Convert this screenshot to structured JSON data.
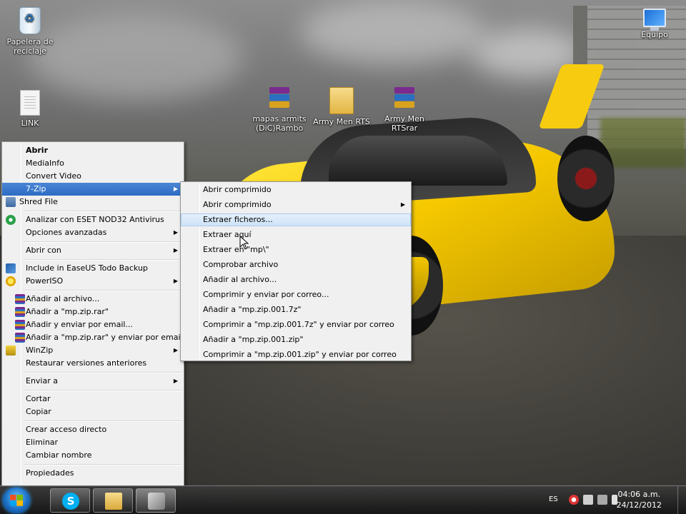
{
  "desktop": {
    "icons": {
      "recycle_bin": "Papelera de reciclaje",
      "link": "LINK",
      "mapas": "mapas armits (DiC)Rambo",
      "army_men_folder": "Army Men RTS",
      "army_men_rar": "Army Men RTSrar",
      "equipo": "Equipo"
    }
  },
  "context_menu": {
    "open": "Abrir",
    "mediainfo": "MediaInfo",
    "convert_video": "Convert Video",
    "seven_zip": "7-Zip",
    "shred_file": "Shred File",
    "eset": "Analizar con ESET NOD32 Antivirus",
    "advanced_options": "Opciones avanzadas",
    "open_with": "Abrir con",
    "easeus": "Include in EaseUS Todo Backup",
    "poweriso": "PowerISO",
    "add_to_archive": "Añadir al archivo...",
    "add_to_mp_rar": "Añadir a \"mp.zip.rar\"",
    "add_and_email": "Añadir y enviar por email...",
    "add_to_mp_rar_email": "Añadir a \"mp.zip.rar\" y enviar por email",
    "winzip": "WinZip",
    "restore_versions": "Restaurar versiones anteriores",
    "send_to": "Enviar a",
    "cut": "Cortar",
    "copy": "Copiar",
    "create_shortcut": "Crear acceso directo",
    "delete": "Eliminar",
    "rename": "Cambiar nombre",
    "properties": "Propiedades"
  },
  "submenu_7zip": {
    "open_archive": "Abrir comprimido",
    "open_archive_sub": "Abrir comprimido",
    "extract_files": "Extraer ficheros...",
    "extract_here": "Extraer aquí",
    "extract_to": "Extraer en \"mp\\\"",
    "test_archive": "Comprobar archivo",
    "add_to_archive": "Añadir al archivo...",
    "compress_email": "Comprimir y enviar por correo...",
    "add_7z": "Añadir a \"mp.zip.001.7z\"",
    "compress_7z_email": "Comprimir a \"mp.zip.001.7z\" y enviar por correo",
    "add_zip": "Añadir a \"mp.zip.001.zip\"",
    "compress_zip_email": "Comprimir a \"mp.zip.001.zip\" y enviar por correo"
  },
  "taskbar": {
    "skype_glyph": "S",
    "language": "ES",
    "time": "04:06 a.m.",
    "date": "24/12/2012"
  },
  "colors": {
    "menu_bg": "#f0f0f0",
    "highlight": "#cde3f8",
    "selected": "#2d6cc3",
    "car_yellow": "#f5c800"
  }
}
